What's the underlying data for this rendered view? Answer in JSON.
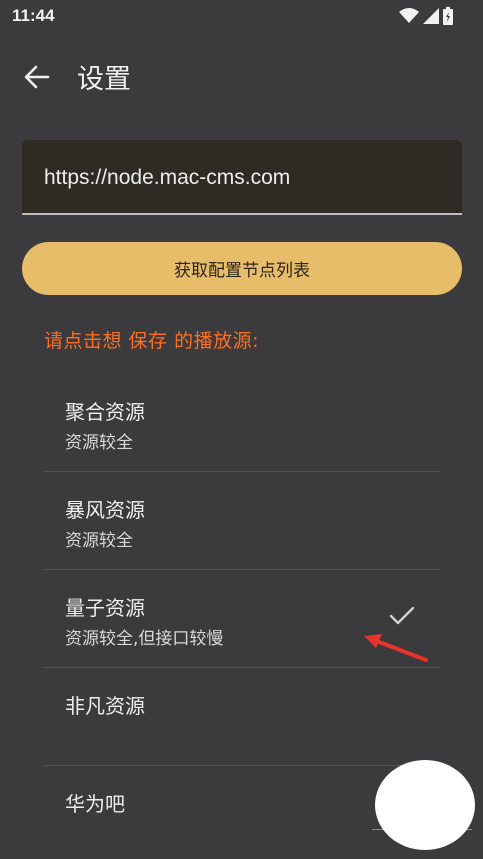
{
  "status_bar": {
    "time": "11:44",
    "icons": [
      "wifi-icon",
      "signal-icon",
      "battery-icon"
    ]
  },
  "app_bar": {
    "title": "设置",
    "back_icon": "arrow-left-icon"
  },
  "url_field": {
    "value": "https://node.mac-cms.com"
  },
  "fetch_button": {
    "label": "获取配置节点列表"
  },
  "hint": {
    "text": "请点击想 保存 的播放源:"
  },
  "sources": [
    {
      "name": "聚合资源",
      "desc": "资源较全",
      "selected": false
    },
    {
      "name": "暴风资源",
      "desc": "资源较全",
      "selected": false
    },
    {
      "name": "量子资源",
      "desc": "资源较全,但接口较慢",
      "selected": true
    },
    {
      "name": "非凡资源",
      "desc": "",
      "selected": false
    },
    {
      "name": "华为吧",
      "desc": "",
      "selected": false
    }
  ],
  "colors": {
    "background": "#3b3a3d",
    "accent_button": "#e8bd6a",
    "hint": "#ff6f1f",
    "annotation_arrow": "#e8332a"
  }
}
